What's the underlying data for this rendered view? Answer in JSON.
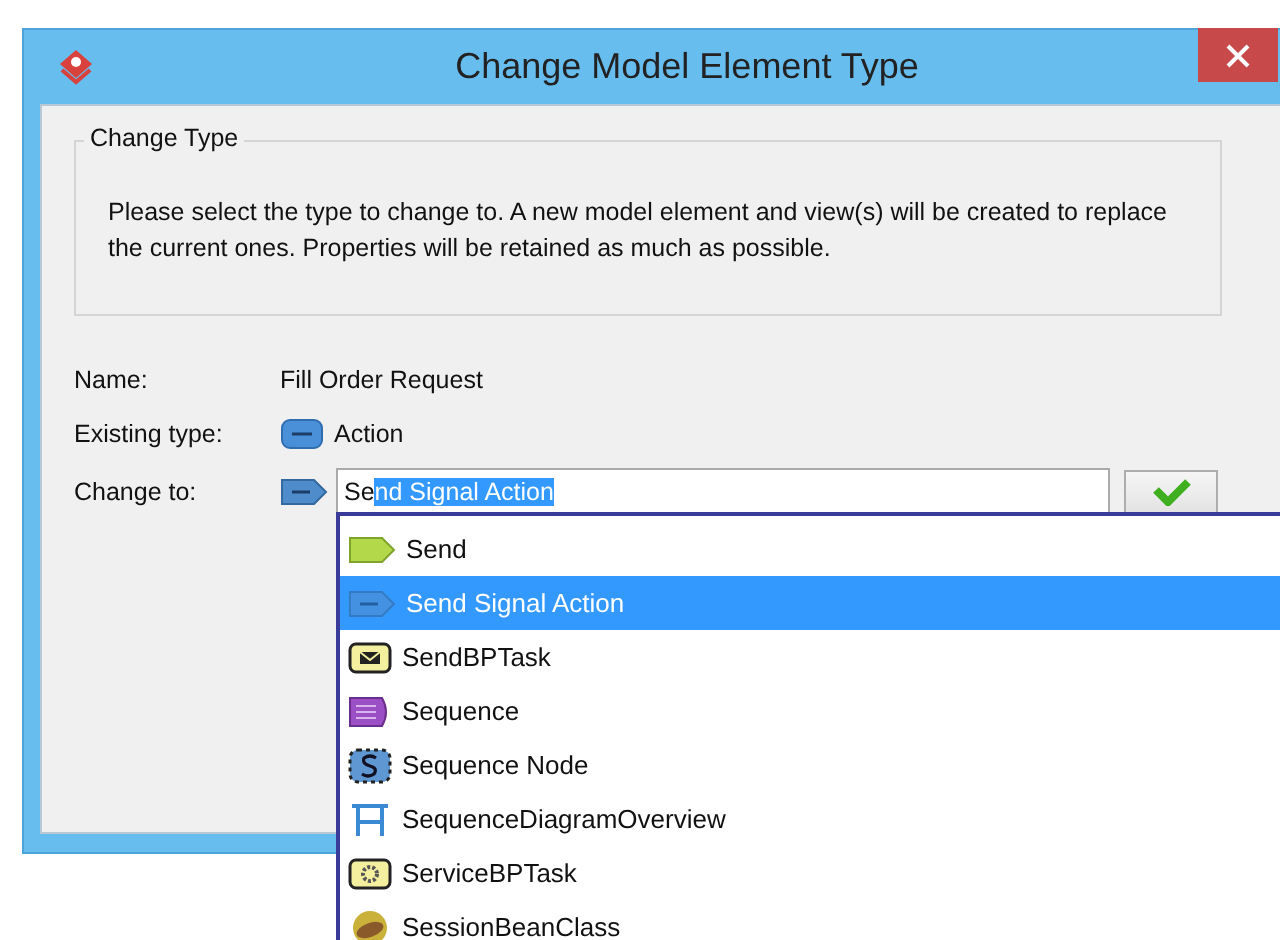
{
  "window": {
    "title": "Change Model Element Type"
  },
  "group": {
    "legend": "Change Type",
    "text": "Please select the type to change to. A new model element and view(s) will be created to replace the current ones. Properties will be retained as much as possible."
  },
  "fields": [
    {
      "kind": "plain",
      "label": "Name:",
      "value": "Fill Order Request"
    },
    {
      "kind": "type",
      "label": "Existing type:",
      "value": "Action"
    }
  ],
  "change_to": {
    "label": "Change to:",
    "typed_text": "Se",
    "selected_text": "nd Signal Action"
  },
  "type_list": [
    {
      "kind": "send",
      "label": "Send",
      "selected": false
    },
    {
      "kind": "signal",
      "label": "Send Signal Action",
      "selected": true
    },
    {
      "kind": "mailtask",
      "label": "SendBPTask",
      "selected": false
    },
    {
      "kind": "sequence",
      "label": "Sequence",
      "selected": false
    },
    {
      "kind": "node",
      "label": "Sequence Node",
      "selected": false
    },
    {
      "kind": "overview",
      "label": "SequenceDiagramOverview",
      "selected": false
    },
    {
      "kind": "geartask",
      "label": "ServiceBPTask",
      "selected": false
    },
    {
      "kind": "bean",
      "label": "SessionBeanClass",
      "selected": false
    }
  ]
}
